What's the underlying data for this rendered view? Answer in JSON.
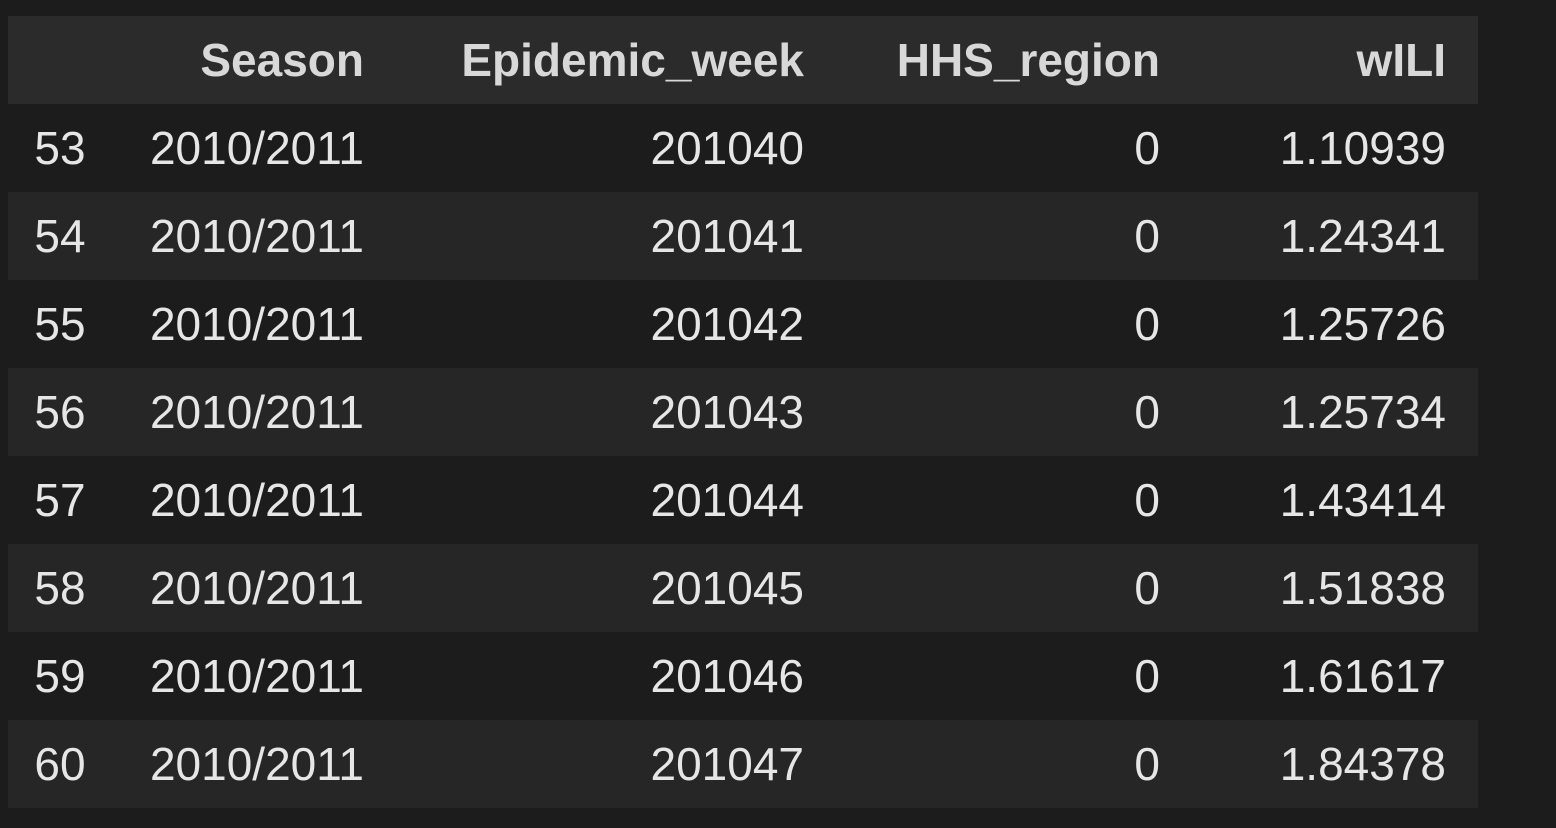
{
  "table": {
    "columns": [
      "",
      "Season",
      "Epidemic_week",
      "HHS_region",
      "wILI"
    ],
    "rows": [
      {
        "index": "53",
        "season": "2010/2011",
        "week": "201040",
        "region": "0",
        "wili": "1.10939"
      },
      {
        "index": "54",
        "season": "2010/2011",
        "week": "201041",
        "region": "0",
        "wili": "1.24341"
      },
      {
        "index": "55",
        "season": "2010/2011",
        "week": "201042",
        "region": "0",
        "wili": "1.25726"
      },
      {
        "index": "56",
        "season": "2010/2011",
        "week": "201043",
        "region": "0",
        "wili": "1.25734"
      },
      {
        "index": "57",
        "season": "2010/2011",
        "week": "201044",
        "region": "0",
        "wili": "1.43414"
      },
      {
        "index": "58",
        "season": "2010/2011",
        "week": "201045",
        "region": "0",
        "wili": "1.51838"
      },
      {
        "index": "59",
        "season": "2010/2011",
        "week": "201046",
        "region": "0",
        "wili": "1.61617"
      },
      {
        "index": "60",
        "season": "2010/2011",
        "week": "201047",
        "region": "0",
        "wili": "1.84378"
      }
    ]
  },
  "colors": {
    "background": "#1c1c1c",
    "header_background": "#2b2b2b",
    "stripe_background": "#262626",
    "text": "#e6e6e6"
  }
}
